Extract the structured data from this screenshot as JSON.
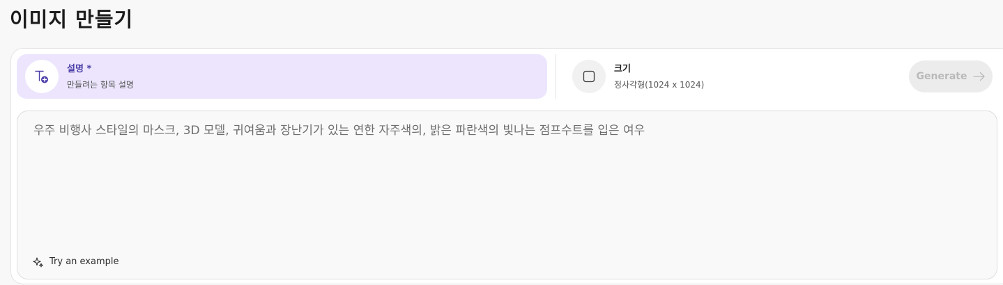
{
  "page": {
    "title": "이미지 만들기"
  },
  "params": {
    "description": {
      "label": "설명 *",
      "sub": "만들려는 항목 설명",
      "icon": "text-add-icon"
    },
    "size": {
      "label": "크기",
      "sub": "정사각형(1024 x 1024)",
      "icon": "square-icon"
    }
  },
  "generate": {
    "label": "Generate",
    "icon": "arrow-right-icon",
    "enabled": false
  },
  "prompt": {
    "placeholder": "우주 비행사 스타일의 마스크, 3D 모델, 귀여움과 장난기가 있는 연한 자주색의, 밝은 파란색의 빛나는 점프수트를 입은 여우"
  },
  "example": {
    "label": "Try an example",
    "icon": "sparkle-icon"
  },
  "colors": {
    "accent": "#4b3fa8",
    "selected_bg": "#ece5fd",
    "disabled_button_bg": "#ececec",
    "disabled_button_text": "#b9b9b9"
  }
}
